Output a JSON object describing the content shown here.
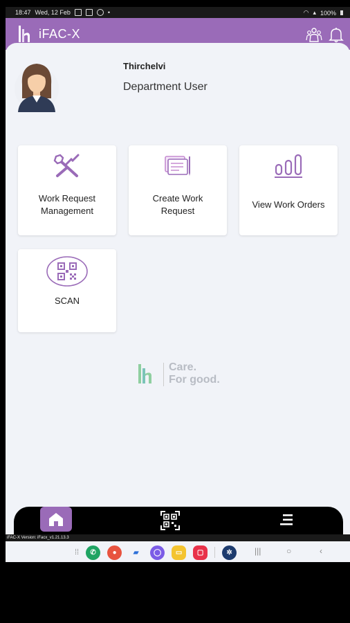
{
  "status_bar": {
    "time": "18:47",
    "date": "Wed, 12 Feb",
    "battery": "100%"
  },
  "app_bar": {
    "title": "iFAC-X"
  },
  "profile": {
    "name": "Thirchelvi",
    "role": "Department User"
  },
  "tiles": [
    {
      "label_line1": "Work Request",
      "label_line2": "Management"
    },
    {
      "label_line1": "Create Work",
      "label_line2": "Request"
    },
    {
      "label_line1": "View Work Orders"
    },
    {
      "label_line1": "SCAN"
    }
  ],
  "brand": {
    "tagline_line1": "Care.",
    "tagline_line2": "For good."
  },
  "version_text": "iFAC-X Version: iFacx_v1.21.13.3",
  "colors": {
    "accent": "#9a6bb8",
    "icon": "#9a6bb8",
    "background": "#f1f3f8"
  },
  "icons": [
    "team-icon",
    "bell-icon",
    "tools-icon",
    "documents-icon",
    "bar-chart-icon",
    "qr-code-icon",
    "home-icon",
    "qr-scan-icon",
    "menu-icon"
  ]
}
